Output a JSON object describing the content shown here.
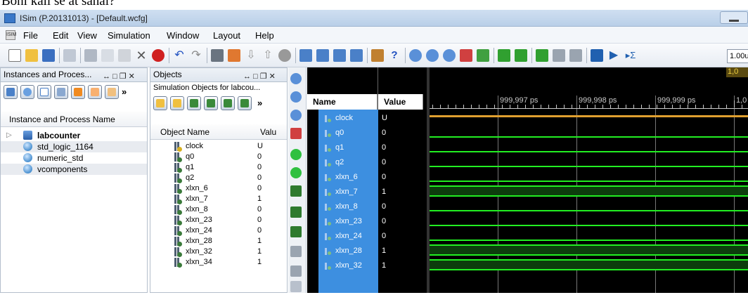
{
  "above_text": "Bohi kali se at sahai?",
  "window": {
    "title": "ISim (P.20131013) - [Default.wcfg]"
  },
  "menu": [
    "File",
    "Edit",
    "View",
    "Simulation",
    "Window",
    "Layout",
    "Help"
  ],
  "toolbar": {
    "zoom_value": "1.00u"
  },
  "instances_panel": {
    "title": "Instances and Proces...",
    "controls": "↔ □ ❐ ✕",
    "column_header": "Instance and Process Name",
    "items": [
      {
        "label": "labcounter",
        "bold": true
      },
      {
        "label": "std_logic_1164"
      },
      {
        "label": "numeric_std"
      },
      {
        "label": "vcomponents"
      }
    ]
  },
  "objects_panel": {
    "title": "Objects",
    "controls": "↔ □ ❐ ✕",
    "subtitle": "Simulation Objects for labcou...",
    "col_name": "Object Name",
    "col_value": "Valu",
    "items": [
      {
        "name": "clock",
        "value": "U"
      },
      {
        "name": "q0",
        "value": "0"
      },
      {
        "name": "q1",
        "value": "0"
      },
      {
        "name": "q2",
        "value": "0"
      },
      {
        "name": "xlxn_6",
        "value": "0"
      },
      {
        "name": "xlxn_7",
        "value": "1"
      },
      {
        "name": "xlxn_8",
        "value": "0"
      },
      {
        "name": "xlxn_23",
        "value": "0"
      },
      {
        "name": "xlxn_24",
        "value": "0"
      },
      {
        "name": "xlxn_28",
        "value": "1"
      },
      {
        "name": "xlxn_32",
        "value": "1"
      },
      {
        "name": "xlxn_34",
        "value": "1"
      }
    ]
  },
  "waveform": {
    "col_name": "Name",
    "col_value": "Value",
    "time_labels": [
      "999,997 ps",
      "999,998 ps",
      "999,999 ps",
      "1,0"
    ],
    "top_marker": "1,0",
    "colors": {
      "background": "#000000",
      "signal_selected": "#3d8fe0",
      "wave_green": "#22ee22",
      "wave_orange": "#e0a030"
    },
    "signals": [
      {
        "name": "clock",
        "value": "U"
      },
      {
        "name": "q0",
        "value": "0"
      },
      {
        "name": "q1",
        "value": "0"
      },
      {
        "name": "q2",
        "value": "0"
      },
      {
        "name": "xlxn_6",
        "value": "0"
      },
      {
        "name": "xlxn_7",
        "value": "1"
      },
      {
        "name": "xlxn_8",
        "value": "0"
      },
      {
        "name": "xlxn_23",
        "value": "0"
      },
      {
        "name": "xlxn_24",
        "value": "0"
      },
      {
        "name": "xlxn_28",
        "value": "1"
      },
      {
        "name": "xlxn_32",
        "value": "1"
      }
    ]
  }
}
